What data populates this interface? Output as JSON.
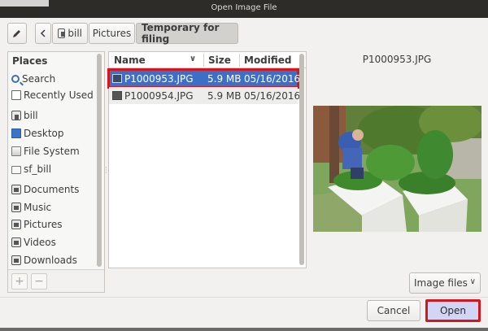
{
  "window": {
    "title": "Open Image File"
  },
  "toolbar": {
    "breadcrumbs": [
      {
        "label": "bill",
        "icon": "home-icon"
      },
      {
        "label": "Pictures"
      },
      {
        "label": "Temporary for filing",
        "active": true
      }
    ]
  },
  "places": {
    "header": "Places",
    "items": [
      {
        "label": "Search",
        "icon": "search-icon"
      },
      {
        "label": "Recently Used",
        "icon": "recent-document-icon"
      },
      {
        "label": "bill",
        "icon": "home-folder-icon"
      },
      {
        "label": "Desktop",
        "icon": "desktop-icon"
      },
      {
        "label": "File System",
        "icon": "drive-icon"
      },
      {
        "label": "sf_bill",
        "icon": "network-share-icon"
      },
      {
        "label": "Documents",
        "icon": "documents-folder-icon"
      },
      {
        "label": "Music",
        "icon": "music-folder-icon"
      },
      {
        "label": "Pictures",
        "icon": "pictures-folder-icon"
      },
      {
        "label": "Videos",
        "icon": "videos-folder-icon"
      },
      {
        "label": "Downloads",
        "icon": "downloads-folder-icon"
      }
    ],
    "add_label": "+",
    "remove_label": "−"
  },
  "files": {
    "columns": {
      "name": "Name",
      "size": "Size",
      "modified": "Modified"
    },
    "rows": [
      {
        "name": "P1000953.JPG",
        "size": "5.9 MB",
        "modified": "05/16/2016",
        "selected": true
      },
      {
        "name": "P1000954.JPG",
        "size": "5.9 MB",
        "modified": "05/16/2016",
        "selected": false
      }
    ]
  },
  "preview": {
    "filename": "P1000953.JPG"
  },
  "filter": {
    "selected": "Image files"
  },
  "actions": {
    "cancel": "Cancel",
    "open": "Open"
  },
  "colors": {
    "selection": "#3d6fc8",
    "highlight_outline": "#d2181f",
    "open_button": "#d2d6f4",
    "titlebar": "#2d2c29"
  }
}
